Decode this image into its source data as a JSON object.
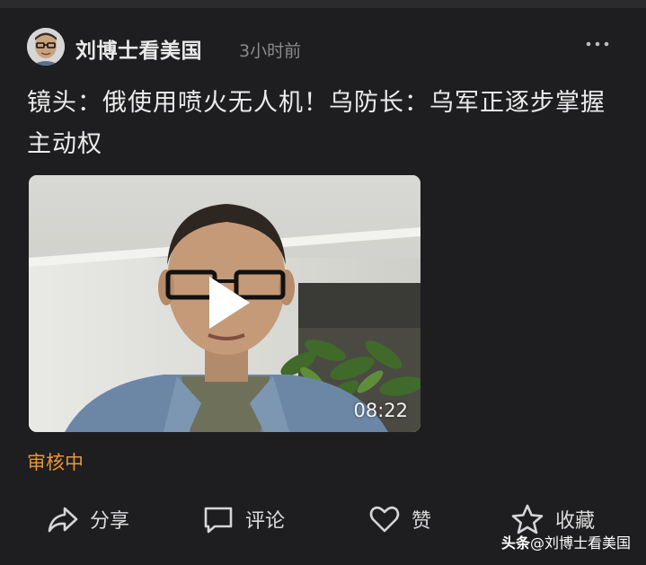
{
  "post": {
    "author": "刘博士看美国",
    "time": "3小时前",
    "title": "镜头：俄使用喷火无人机！乌防长：乌军正逐步掌握主动权",
    "video": {
      "duration": "08:22"
    },
    "status": "审核中"
  },
  "actions": {
    "share_label": "分享",
    "comment_label": "评论",
    "like_label": "赞",
    "favorite_label": "收藏"
  },
  "watermark": {
    "brand": "头条",
    "handle": "@刘博士看美国"
  },
  "colors": {
    "background": "#1e1e20",
    "status": "#e89735",
    "text": "#ececec",
    "muted": "#8a8a8c"
  }
}
